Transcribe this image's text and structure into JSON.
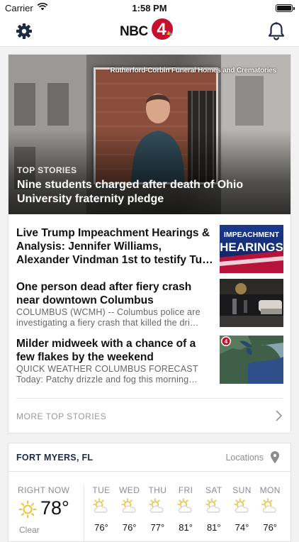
{
  "status_bar": {
    "carrier": "Carrier",
    "time": "1:58 PM"
  },
  "header": {
    "logo_text": "NBC",
    "logo_number": "4"
  },
  "hero": {
    "image_caption": "Rutherford-Corbin Funeral Homes and Crematories",
    "section": "TOP STORIES",
    "title": "Nine students charged after death of Ohio University fraternity pledge"
  },
  "stories": [
    {
      "title": "Live Trump Impeachment Hearings & Analysis: Jennifer Williams, Alexander Vindman 1st to testify Tu…",
      "description": "",
      "thumb_text": [
        "IMPEACHMENT",
        "HEARINGS"
      ]
    },
    {
      "title": "One person dead after fiery crash near downtown Columbus",
      "description": "COLUMBUS (WCMH) -- Columbus police are investigating a fiery crash that killed the dri…"
    },
    {
      "title": "Milder midweek with a chance of a few flakes by the weekend",
      "description": "QUICK WEATHER COLUMBUS FORECAST Today: Patchy drizzle and fog this morning…",
      "thumb_badge": "4"
    }
  ],
  "more_label": "MORE TOP STORIES",
  "weather": {
    "location": "FORT MYERS, FL",
    "locations_label": "Locations",
    "now": {
      "label": "RIGHT NOW",
      "temp": "78°",
      "condition": "Clear",
      "icon": "sun-icon"
    },
    "forecast": [
      {
        "day": "TUE",
        "temp": "76°",
        "icon": "partly-cloudy-icon"
      },
      {
        "day": "WED",
        "temp": "76°",
        "icon": "partly-cloudy-icon"
      },
      {
        "day": "THU",
        "temp": "77°",
        "icon": "partly-cloudy-icon"
      },
      {
        "day": "FRI",
        "temp": "81°",
        "icon": "partly-cloudy-icon"
      },
      {
        "day": "SAT",
        "temp": "81°",
        "icon": "partly-cloudy-icon"
      },
      {
        "day": "SUN",
        "temp": "74°",
        "icon": "partly-cloudy-icon"
      },
      {
        "day": "MON",
        "temp": "76°",
        "icon": "partly-cloudy-icon"
      }
    ]
  },
  "colors": {
    "accent_yellow": "#f2c231",
    "nav_icon": "#1e2a44",
    "muted_text": "#8c8c8c"
  }
}
